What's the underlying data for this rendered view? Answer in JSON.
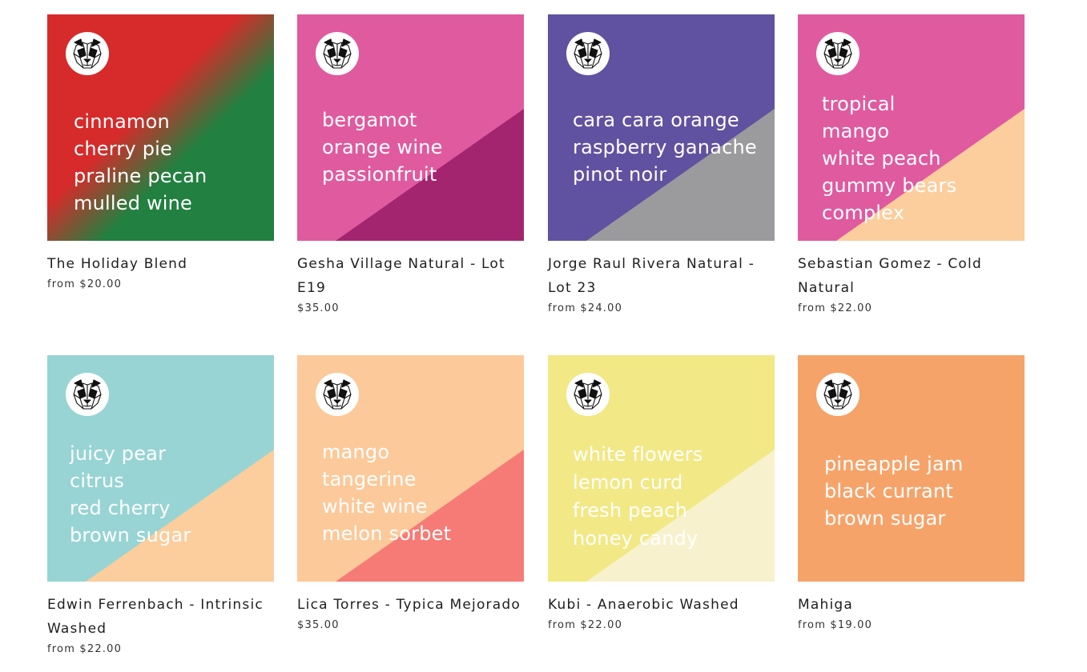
{
  "products": [
    {
      "title": "The Holiday Blend",
      "price": "from $20.00",
      "notes": [
        "cinnamon",
        "cherry pie",
        "praline pecan",
        "mulled wine"
      ],
      "style": "gradient",
      "colors": {
        "primary": "#d72a2a",
        "secondary": "#228040"
      }
    },
    {
      "title": "Gesha Village Natural - Lot E19",
      "price": "$35.00",
      "notes": [
        "bergamot",
        "orange wine",
        "passionfruit"
      ],
      "style": "split",
      "colors": {
        "primary": "#e05a9f",
        "secondary": "#a32570"
      }
    },
    {
      "title": "Jorge Raul Rivera Natural - Lot 23",
      "price": "from $24.00",
      "notes": [
        "cara cara orange",
        "raspberry ganache",
        "pinot noir"
      ],
      "style": "split",
      "colors": {
        "primary": "#6052a0",
        "secondary": "#9b9b9e"
      }
    },
    {
      "title": "Sebastian Gomez - Cold Natural",
      "price": "from $22.00",
      "notes": [
        "tropical",
        "mango",
        "white peach",
        "gummy bears",
        "complex"
      ],
      "style": "split",
      "colors": {
        "primary": "#e05aa0",
        "secondary": "#fccd9d"
      }
    },
    {
      "title": "Edwin Ferrenbach - Intrinsic Washed",
      "price": "from $22.00",
      "notes": [
        "juicy pear",
        "citrus",
        "red cherry",
        "brown sugar"
      ],
      "style": "split",
      "colors": {
        "primary": "#98d4d4",
        "secondary": "#fccd9d"
      }
    },
    {
      "title": "Lica Torres - Typica Mejorado",
      "price": "$35.00",
      "notes": [
        "mango",
        "tangerine",
        "white wine",
        "melon sorbet"
      ],
      "style": "split",
      "colors": {
        "primary": "#fcc99a",
        "secondary": "#f67b76"
      }
    },
    {
      "title": "Kubi - Anaerobic Washed",
      "price": "from $22.00",
      "notes": [
        "white flowers",
        "lemon curd",
        "fresh peach",
        "honey candy"
      ],
      "style": "split",
      "colors": {
        "primary": "#f2e885",
        "secondary": "#f7f2cd"
      }
    },
    {
      "title": "Mahiga",
      "price": "from $19.00",
      "notes": [
        "pineapple jam",
        "black currant",
        "brown sugar"
      ],
      "style": "solid",
      "colors": {
        "primary": "#f6a36a",
        "secondary": "#f6a36a"
      }
    }
  ]
}
